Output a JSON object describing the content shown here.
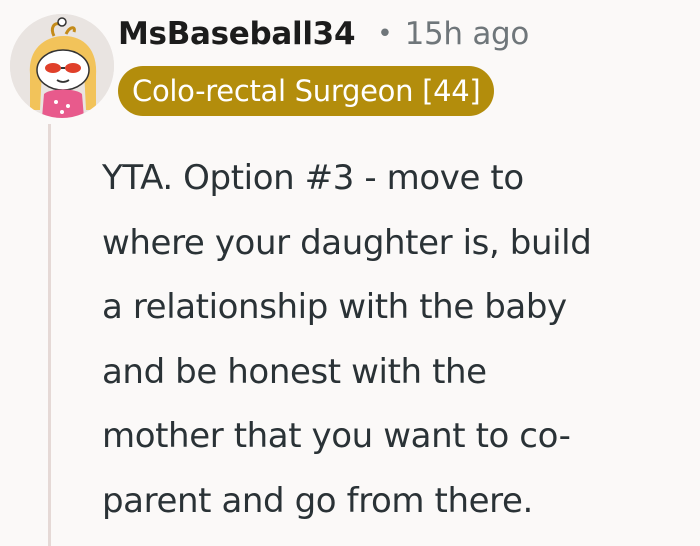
{
  "comment": {
    "username": "MsBaseball34",
    "separator": "•",
    "timestamp": "15h ago",
    "flair": "Colo-rectal Surgeon [44]",
    "body_lines": [
      "YTA. Option #3 - move to",
      "where your daughter is, build",
      "a relationship with the baby",
      "and be honest with the",
      "mother that you want to co-",
      "parent and go from there."
    ]
  },
  "colors": {
    "background": "#fbf9f8",
    "flair_background": "#b38d0c",
    "flair_text": "#ffffff",
    "username": "#1c1c1c",
    "meta_text": "#6f767a",
    "body_text": "#2a3236",
    "thread_line": "#e5d9d6"
  },
  "icons": {
    "avatar": "snoo-avatar-icon"
  }
}
